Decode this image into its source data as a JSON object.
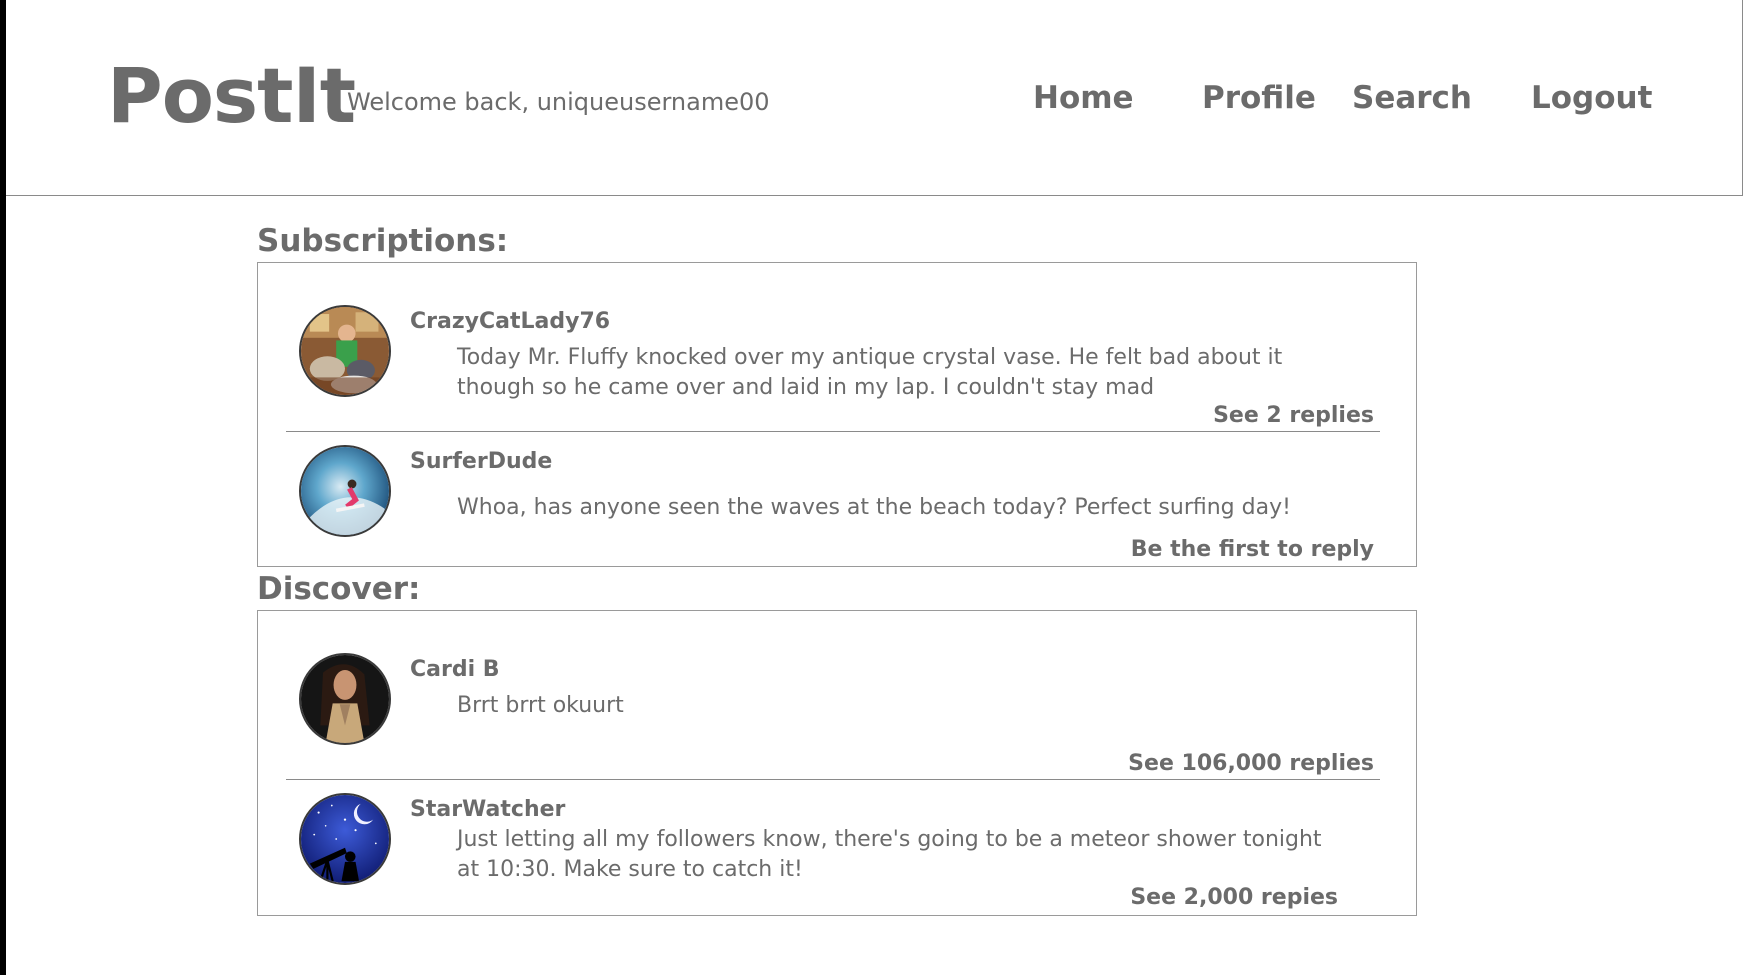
{
  "app": {
    "logo": "PostIt",
    "welcome": "Welcome back, uniqueusername00"
  },
  "nav": {
    "home": "Home",
    "profile": "Profile",
    "search": "Search",
    "logout": "Logout"
  },
  "subscriptions": {
    "title": "Subscriptions:",
    "posts": [
      {
        "author": "CrazyCatLady76",
        "avatar_icon": "cat-lady-photo",
        "content": "Today Mr. Fluffy knocked over my antique crystal vase.  He felt bad about it though so he came over and laid in my lap.  I couldn't stay mad",
        "replies": "See 2 replies"
      },
      {
        "author": "SurferDude",
        "avatar_icon": "surfer-wave-photo",
        "content": "Whoa, has anyone seen the waves at the beach today?  Perfect surfing day!",
        "replies": "Be the first to reply"
      }
    ]
  },
  "discover": {
    "title": "Discover:",
    "posts": [
      {
        "author": "Cardi B",
        "avatar_icon": "cardi-b-photo",
        "content": "Brrt brrt okuurt",
        "replies": "See 106,000 replies"
      },
      {
        "author": "StarWatcher",
        "avatar_icon": "telescope-night-sky-photo",
        "content": "Just letting all my followers know, there's going to be a meteor shower tonight at 10:30.  Make sure to catch it!",
        "replies": "See 2,000 repies"
      }
    ]
  },
  "colors": {
    "text": "#6b6b6b",
    "border": "#9a9a9a",
    "background": "#ffffff",
    "frame": "#000000"
  }
}
